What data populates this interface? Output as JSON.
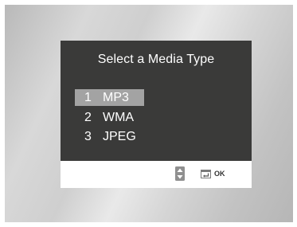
{
  "dialog": {
    "title": "Select a Media Type",
    "items": [
      {
        "number": "1",
        "label": "MP3",
        "selected": true
      },
      {
        "number": "2",
        "label": "WMA",
        "selected": false
      },
      {
        "number": "3",
        "label": "JPEG",
        "selected": false
      }
    ],
    "footer": {
      "navigate_icon": "up-down-arrows-icon",
      "confirm_icon": "enter-icon",
      "confirm_label": "OK"
    }
  },
  "colors": {
    "dialog_bg": "#3a3a39",
    "selection_highlight": "#a3a3a3",
    "footer_bg": "#ffffff",
    "text": "#ffffff"
  }
}
